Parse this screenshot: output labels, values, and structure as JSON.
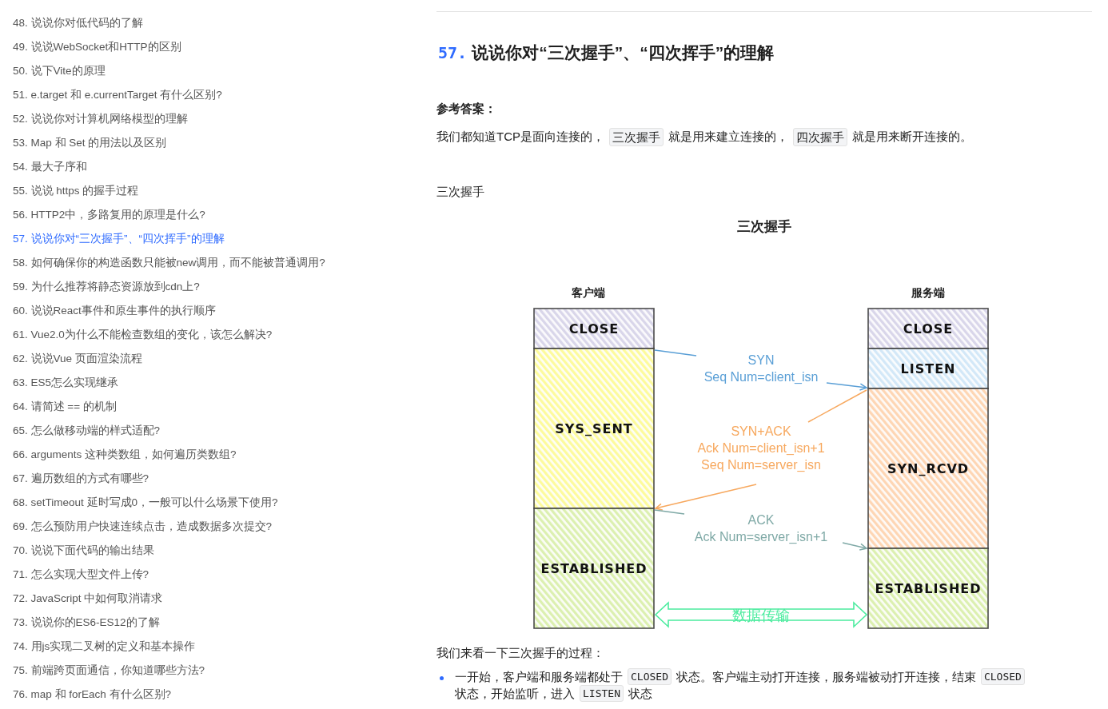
{
  "sidebar": {
    "items": [
      {
        "label": "48. 说说你对低代码的了解",
        "selected": false
      },
      {
        "label": "49. 说说WebSocket和HTTP的区别",
        "selected": false
      },
      {
        "label": "50. 说下Vite的原理",
        "selected": false
      },
      {
        "label": "51. e.target 和 e.currentTarget 有什么区别?",
        "selected": false
      },
      {
        "label": "52. 说说你对计算机网络模型的理解",
        "selected": false
      },
      {
        "label": "53. Map 和 Set 的用法以及区别",
        "selected": false
      },
      {
        "label": "54. 最大子序和",
        "selected": false
      },
      {
        "label": "55. 说说 https 的握手过程",
        "selected": false
      },
      {
        "label": "56. HTTP2中，多路复用的原理是什么?",
        "selected": false
      },
      {
        "label": "57. 说说你对“三次握手”、“四次挥手”的理解",
        "selected": true
      },
      {
        "label": "58. 如何确保你的构造函数只能被new调用，而不能被普通调用?",
        "selected": false
      },
      {
        "label": "59. 为什么推荐将静态资源放到cdn上?",
        "selected": false
      },
      {
        "label": "60. 说说React事件和原生事件的执行顺序",
        "selected": false
      },
      {
        "label": "61. Vue2.0为什么不能检查数组的变化，该怎么解决?",
        "selected": false
      },
      {
        "label": "62. 说说Vue 页面渲染流程",
        "selected": false
      },
      {
        "label": "63. ES5怎么实现继承",
        "selected": false
      },
      {
        "label": "64. 请简述 == 的机制",
        "selected": false
      },
      {
        "label": "65. 怎么做移动端的样式适配?",
        "selected": false
      },
      {
        "label": "66. arguments 这种类数组，如何遍历类数组?",
        "selected": false
      },
      {
        "label": "67. 遍历数组的方式有哪些?",
        "selected": false
      },
      {
        "label": "68. setTimeout 延时写成0，一般可以什么场景下使用?",
        "selected": false
      },
      {
        "label": "69. 怎么预防用户快速连续点击，造成数据多次提交?",
        "selected": false
      },
      {
        "label": "70. 说说下面代码的输出结果",
        "selected": false
      },
      {
        "label": "71. 怎么实现大型文件上传?",
        "selected": false
      },
      {
        "label": "72. JavaScript 中如何取消请求",
        "selected": false
      },
      {
        "label": "73. 说说你的ES6-ES12的了解",
        "selected": false
      },
      {
        "label": "74. 用js实现二叉树的定义和基本操作",
        "selected": false
      },
      {
        "label": "75. 前端跨页面通信，你知道哪些方法?",
        "selected": false
      },
      {
        "label": "76. map 和 forEach 有什么区别?",
        "selected": false
      }
    ]
  },
  "article": {
    "heading_number": "57.",
    "heading": "说说你对“三次握手”、“四次挥手”的理解",
    "answer_label": "参考答案：",
    "intro": [
      {
        "kind": "text",
        "text": "我们都知道TCP是面向连接的，"
      },
      {
        "kind": "code",
        "text": "三次握手"
      },
      {
        "kind": "text",
        "text": "就是用来建立连接的，"
      },
      {
        "kind": "code",
        "text": "四次握手"
      },
      {
        "kind": "text",
        "text": "就是用来断开连接的。"
      }
    ],
    "subheading": "三次握手",
    "diagram": {
      "title": "三次握手",
      "client_label": "客户端",
      "server_label": "服务端",
      "client_states": [
        {
          "label": "CLOSE",
          "color": "#d9d6ea"
        },
        {
          "label": "SYS_SENT",
          "color": "#fdfb9c"
        },
        {
          "label": "ESTABLISHED",
          "color": "#dcf0b0"
        }
      ],
      "server_states": [
        {
          "label": "CLOSE",
          "color": "#d9d6ea"
        },
        {
          "label": "LISTEN",
          "color": "#d3e8f8"
        },
        {
          "label": "SYN_RCVD",
          "color": "#fed6b4"
        },
        {
          "label": "ESTABLISHED",
          "color": "#dcf0b0"
        }
      ],
      "messages": [
        {
          "lines": [
            "SYN",
            "Seq Num=client_isn"
          ],
          "color": "#5a9fd6"
        },
        {
          "lines": [
            "SYN+ACK",
            "Ack Num=client_isn+1",
            "Seq Num=server_isn"
          ],
          "color": "#f7a85e"
        },
        {
          "lines": [
            "ACK",
            "Ack Num=server_isn+1"
          ],
          "color": "#7fa9a6"
        }
      ],
      "transfer_label": "数据传输"
    },
    "process_intro": "我们来看一下三次握手的过程：",
    "bullets": [
      {
        "segments": [
          {
            "kind": "text",
            "text": "一开始，客户端和服务端都处于"
          },
          {
            "kind": "code",
            "text": "CLOSED"
          },
          {
            "kind": "text",
            "text": "状态。客户端主动打开连接，服务端被动打开连接，结束"
          },
          {
            "kind": "code",
            "text": "CLOSED"
          },
          {
            "kind": "text",
            "text": "状态，开始监听，进入"
          },
          {
            "kind": "code",
            "text": "LISTEN"
          },
          {
            "kind": "text",
            "text": "状态"
          }
        ]
      }
    ]
  }
}
